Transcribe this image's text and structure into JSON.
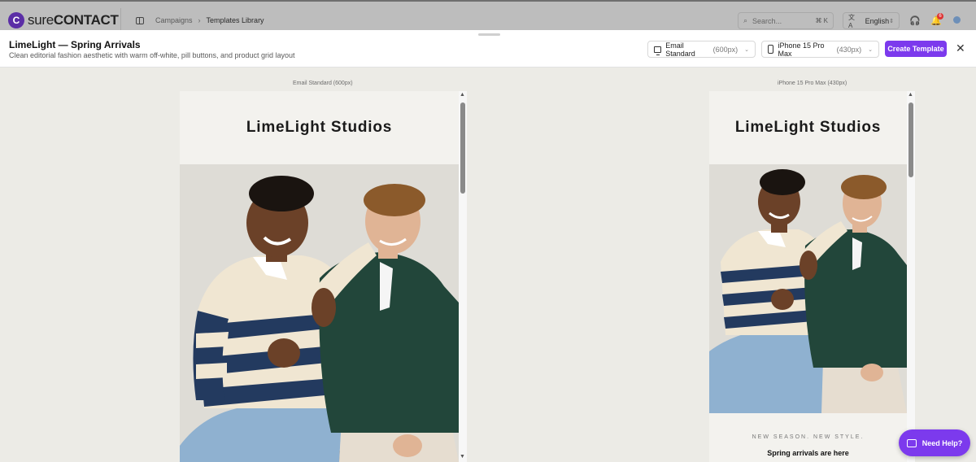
{
  "app": {
    "logo_text_a": "sure",
    "logo_text_b": "CONTACT",
    "logo_mark": "C"
  },
  "breadcrumb": {
    "items": [
      "Campaigns",
      "Templates Library"
    ],
    "separator": "›"
  },
  "topbar": {
    "search_placeholder": "Search...",
    "search_shortcut": "⌘ K",
    "language": "English",
    "notification_count": "6"
  },
  "modal": {
    "title": "LimeLight — Spring Arrivals",
    "subtitle": "Clean editorial fashion aesthetic with warm off-white, pill buttons, and product grid layout",
    "email_select": {
      "label": "Email Standard",
      "size": "(600px)"
    },
    "device_select": {
      "label": "iPhone 15 Pro Max",
      "size": "(430px)"
    },
    "create_button": "Create Template",
    "close_icon": "close-icon"
  },
  "previews": {
    "desktop": {
      "label": "Email Standard (600px)",
      "brand": "LimeLight Studios"
    },
    "mobile": {
      "label": "iPhone 15 Pro Max (430px)",
      "brand": "LimeLight Studios",
      "kicker": "NEW SEASON. NEW STYLE.",
      "headline": "Spring arrivals are here"
    }
  },
  "help": {
    "label": "Need Help?"
  },
  "colors": {
    "accent": "#7c3aed",
    "canvas": "#ecebe6",
    "email_header": "#f3f2ee"
  }
}
